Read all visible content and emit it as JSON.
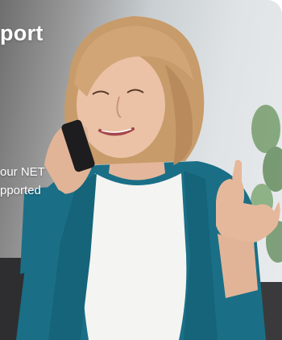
{
  "banner": {
    "headline": "port",
    "subtext_line1": "our NET",
    "subtext_line2": "pported"
  }
}
